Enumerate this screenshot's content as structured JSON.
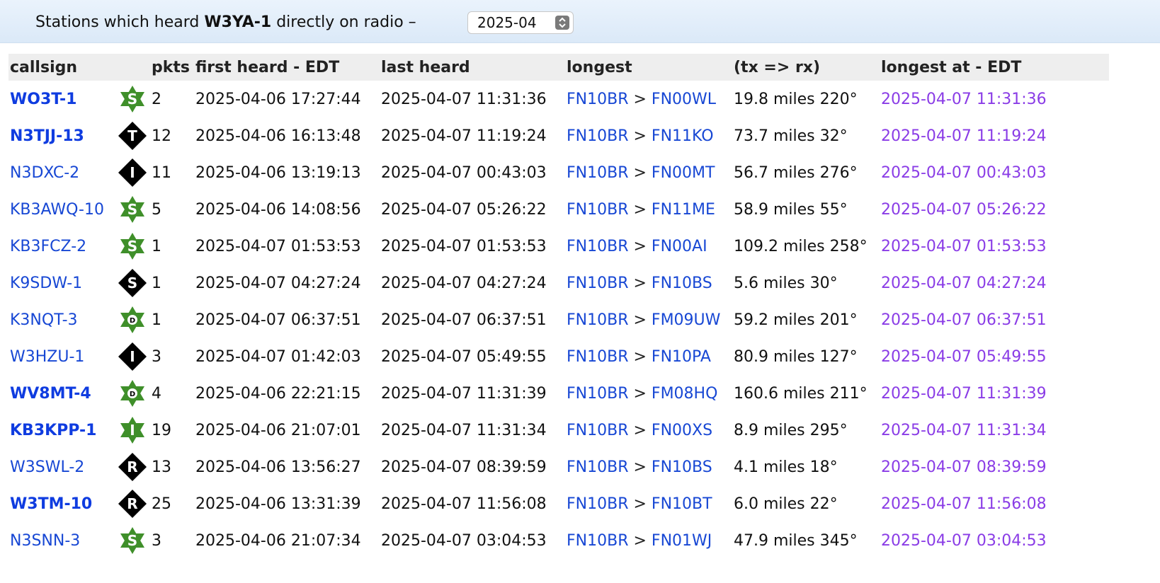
{
  "header": {
    "prefix": "Stations which heard ",
    "station": "W3YA-1",
    "suffix": " directly on radio –",
    "month_selected": "2025-04"
  },
  "table": {
    "columns": [
      "callsign",
      "",
      "pkts",
      "first heard - EDT",
      "last heard",
      "longest",
      "(tx => rx)",
      "longest at - EDT"
    ],
    "separator": ">",
    "rows": [
      {
        "callsign": "WO3T-1",
        "bold": true,
        "symbol": {
          "shape": "star",
          "letter": "S",
          "icon": "star-s-icon"
        },
        "pkts": "2",
        "first": "2025-04-06 17:27:44",
        "last": "2025-04-07 11:31:36",
        "from": "FN10BR",
        "to": "FN00WL",
        "dist": "19.8 miles 220°",
        "at": "2025-04-07 11:31:36"
      },
      {
        "callsign": "N3TJJ-13",
        "bold": true,
        "symbol": {
          "shape": "diamond",
          "letter": "T",
          "icon": "diamond-t-icon"
        },
        "pkts": "12",
        "first": "2025-04-06 16:13:48",
        "last": "2025-04-07 11:19:24",
        "from": "FN10BR",
        "to": "FN11KO",
        "dist": "73.7 miles 32°",
        "at": "2025-04-07 11:19:24"
      },
      {
        "callsign": "N3DXC-2",
        "bold": false,
        "symbol": {
          "shape": "diamond",
          "letter": "I",
          "icon": "diamond-i-icon"
        },
        "pkts": "11",
        "first": "2025-04-06 13:19:13",
        "last": "2025-04-07 00:43:03",
        "from": "FN10BR",
        "to": "FN00MT",
        "dist": "56.7 miles 276°",
        "at": "2025-04-07 00:43:03"
      },
      {
        "callsign": "KB3AWQ-10",
        "bold": false,
        "symbol": {
          "shape": "star",
          "letter": "S",
          "icon": "star-s-icon"
        },
        "pkts": "5",
        "first": "2025-04-06 14:08:56",
        "last": "2025-04-07 05:26:22",
        "from": "FN10BR",
        "to": "FN11ME",
        "dist": "58.9 miles 55°",
        "at": "2025-04-07 05:26:22"
      },
      {
        "callsign": "KB3FCZ-2",
        "bold": false,
        "symbol": {
          "shape": "star",
          "letter": "S",
          "icon": "star-s-icon"
        },
        "pkts": "1",
        "first": "2025-04-07 01:53:53",
        "last": "2025-04-07 01:53:53",
        "from": "FN10BR",
        "to": "FN00AI",
        "dist": "109.2 miles 258°",
        "at": "2025-04-07 01:53:53"
      },
      {
        "callsign": "K9SDW-1",
        "bold": false,
        "symbol": {
          "shape": "diamond",
          "letter": "S",
          "icon": "diamond-s-icon"
        },
        "pkts": "1",
        "first": "2025-04-07 04:27:24",
        "last": "2025-04-07 04:27:24",
        "from": "FN10BR",
        "to": "FN10BS",
        "dist": "5.6 miles 30°",
        "at": "2025-04-07 04:27:24"
      },
      {
        "callsign": "K3NQT-3",
        "bold": false,
        "symbol": {
          "shape": "star",
          "letter": "D",
          "icon": "star-d-icon"
        },
        "pkts": "1",
        "first": "2025-04-07 06:37:51",
        "last": "2025-04-07 06:37:51",
        "from": "FN10BR",
        "to": "FM09UW",
        "dist": "59.2 miles 201°",
        "at": "2025-04-07 06:37:51"
      },
      {
        "callsign": "W3HZU-1",
        "bold": false,
        "symbol": {
          "shape": "diamond",
          "letter": "I",
          "icon": "diamond-i-icon"
        },
        "pkts": "3",
        "first": "2025-04-07 01:42:03",
        "last": "2025-04-07 05:49:55",
        "from": "FN10BR",
        "to": "FN10PA",
        "dist": "80.9 miles 127°",
        "at": "2025-04-07 05:49:55"
      },
      {
        "callsign": "WV8MT-4",
        "bold": true,
        "symbol": {
          "shape": "star",
          "letter": "D",
          "icon": "star-d-icon"
        },
        "pkts": "4",
        "first": "2025-04-06 22:21:15",
        "last": "2025-04-07 11:31:39",
        "from": "FN10BR",
        "to": "FM08HQ",
        "dist": "160.6 miles 211°",
        "at": "2025-04-07 11:31:39"
      },
      {
        "callsign": "KB3KPP-1",
        "bold": true,
        "symbol": {
          "shape": "star",
          "letter": "I",
          "icon": "star-i-icon"
        },
        "pkts": "19",
        "first": "2025-04-06 21:07:01",
        "last": "2025-04-07 11:31:34",
        "from": "FN10BR",
        "to": "FN00XS",
        "dist": "8.9 miles 295°",
        "at": "2025-04-07 11:31:34"
      },
      {
        "callsign": "W3SWL-2",
        "bold": false,
        "symbol": {
          "shape": "diamond",
          "letter": "R",
          "icon": "diamond-r-icon"
        },
        "pkts": "13",
        "first": "2025-04-06 13:56:27",
        "last": "2025-04-07 08:39:59",
        "from": "FN10BR",
        "to": "FN10BS",
        "dist": "4.1 miles 18°",
        "at": "2025-04-07 08:39:59"
      },
      {
        "callsign": "W3TM-10",
        "bold": true,
        "symbol": {
          "shape": "diamond",
          "letter": "R",
          "icon": "diamond-r-icon"
        },
        "pkts": "25",
        "first": "2025-04-06 13:31:39",
        "last": "2025-04-07 11:56:08",
        "from": "FN10BR",
        "to": "FN10BT",
        "dist": "6.0 miles 22°",
        "at": "2025-04-07 11:56:08"
      },
      {
        "callsign": "N3SNN-3",
        "bold": false,
        "symbol": {
          "shape": "star",
          "letter": "S",
          "icon": "star-s-icon"
        },
        "pkts": "3",
        "first": "2025-04-06 21:07:34",
        "last": "2025-04-07 03:04:53",
        "from": "FN10BR",
        "to": "FN01WJ",
        "dist": "47.9 miles 345°",
        "at": "2025-04-07 03:04:53"
      }
    ]
  },
  "colors": {
    "link": "#1747d4",
    "longest_at": "#8a3ce6",
    "star_green": "#3f8f2a",
    "diamond_black": "#000000",
    "header_bg": "#dbe9f8"
  }
}
